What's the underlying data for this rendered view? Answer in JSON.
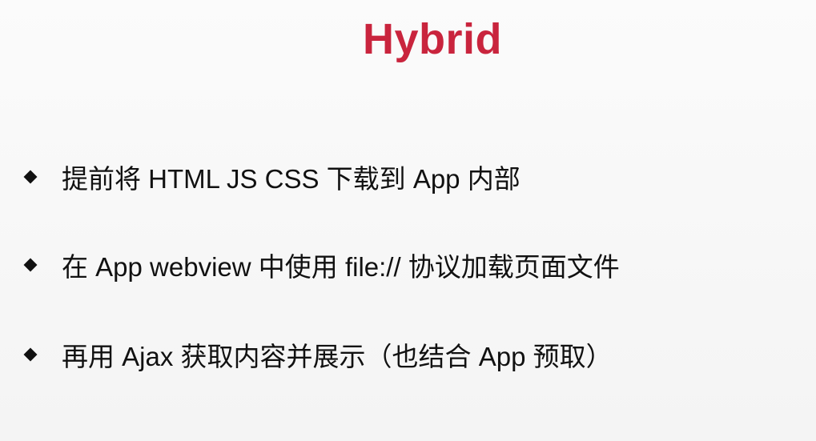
{
  "slide": {
    "title": "Hybrid",
    "bullets": [
      {
        "text": "提前将 HTML JS CSS 下载到 App 内部"
      },
      {
        "text": "在 App webview 中使用 file:// 协议加载页面文件"
      },
      {
        "text": "再用 Ajax 获取内容并展示（也结合 App 预取）"
      }
    ]
  }
}
